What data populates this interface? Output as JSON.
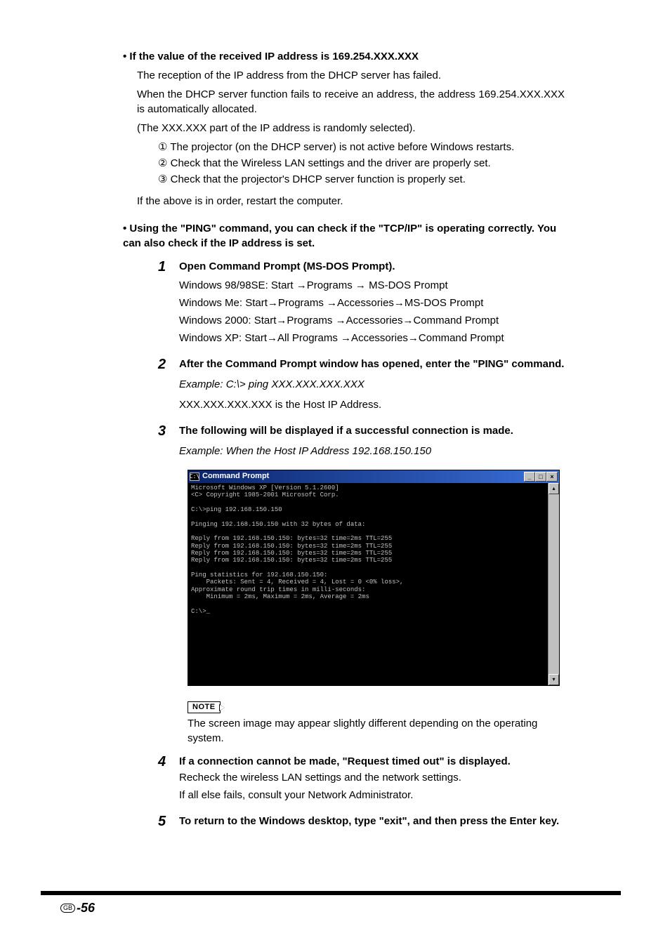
{
  "heading1": "If the value of the received IP address is 169.254.XXX.XXX",
  "para1a": "The reception of the IP address from the DHCP server has failed.",
  "para1b": "When the DHCP server function fails to receive an address, the address 169.254.XXX.XXX is automatically allocated.",
  "para1c": "(The XXX.XXX part of the IP address is randomly selected).",
  "check1": "① The projector (on the DHCP server) is not active before Windows restarts.",
  "check2": "② Check that the Wireless LAN settings and the driver are properly set.",
  "check3": "③ Check that the projector's DHCP server function is properly set.",
  "para1d": "If the above is in order, restart the computer.",
  "heading2": "Using the \"PING\" command, you can check if the \"TCP/IP\" is operating correctly. You can also check if the IP address is set.",
  "steps": {
    "s1": {
      "title": "Open Command Prompt (MS-DOS Prompt).",
      "l1": "Windows 98/98SE: Start →Programs → MS-DOS Prompt",
      "l2": "Windows Me: Start→Programs →Accessories→MS-DOS Prompt",
      "l3": "Windows 2000: Start→Programs →Accessories→Command Prompt",
      "l4": "Windows XP: Start→All Programs →Accessories→Command Prompt"
    },
    "s2": {
      "title": "After the Command Prompt window has opened, enter the \"PING\" command.",
      "example": "Example:    C:\\> ping XXX.XXX.XXX.XXX",
      "note": "XXX.XXX.XXX.XXX is the Host IP Address."
    },
    "s3": {
      "title": "The following will be displayed if a successful connection is made.",
      "example": "Example: When the Host IP Address 192.168.150.150"
    },
    "s4": {
      "title": "If a connection cannot be made, \"Request timed out\" is displayed.",
      "l1": "Recheck the wireless LAN settings and the network settings.",
      "l2": "If all else fails, consult your Network Administrator."
    },
    "s5": {
      "title": "To return to the Windows desktop, type \"exit\", and then press the Enter key."
    }
  },
  "cmd": {
    "title": "Command Prompt",
    "body": "Microsoft Windows XP [Version 5.1.2600]\n<C> Copyright 1985-2001 Microsoft Corp.\n\nC:\\>ping 192.168.150.150\n\nPinging 192.168.150.150 with 32 bytes of data:\n\nReply from 192.168.150.150: bytes=32 time=2ms TTL=255\nReply from 192.168.150.150: bytes=32 time=2ms TTL=255\nReply from 192.168.150.150: bytes=32 time=2ms TTL=255\nReply from 192.168.150.150: bytes=32 time=2ms TTL=255\n\nPing statistics for 192.168.150.150:\n    Packets: Sent = 4, Received = 4, Lost = 0 <0% loss>,\nApproximate round trip times in milli-seconds:\n    Minimum = 2ms, Maximum = 2ms, Average = 2ms\n\nC:\\>_"
  },
  "note": {
    "label": "NOTE",
    "text": "The screen image may appear slightly different depending on the operating system."
  },
  "footer": {
    "gb": "GB",
    "page": "-56"
  }
}
